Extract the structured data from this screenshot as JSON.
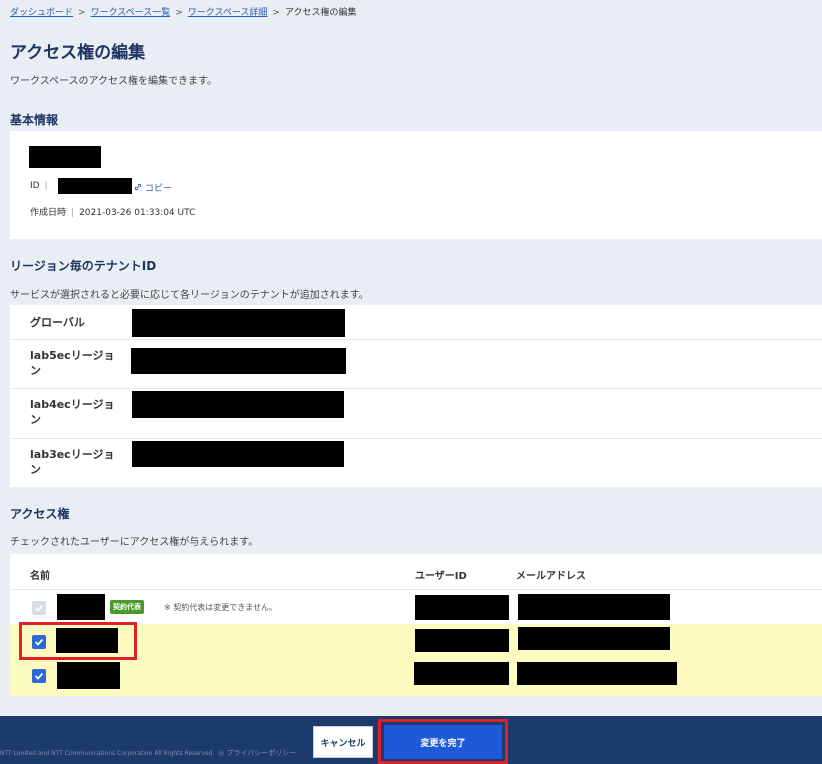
{
  "breadcrumb": {
    "items": [
      "ダッシュボード",
      "ワークスペース一覧",
      "ワークスペース詳細"
    ],
    "current": "アクセス権の編集",
    "separator": ">"
  },
  "page": {
    "title": "アクセス権の編集",
    "description": "ワークスペースのアクセス権を編集できます。"
  },
  "basic_info": {
    "heading": "基本情報",
    "id_label": "ID",
    "copy_label": "コピー",
    "created_label": "作成日時",
    "created_value": "2021-03-26 01:33:04 UTC"
  },
  "regions": {
    "heading": "リージョン毎のテナントID",
    "description": "サービスが選択されると必要に応じて各リージョンのテナントが追加されます。",
    "rows": [
      {
        "label": "グローバル"
      },
      {
        "label": "lab5ecリージョン"
      },
      {
        "label": "lab4ecリージョン"
      },
      {
        "label": "lab3ecリージョン"
      }
    ]
  },
  "access": {
    "heading": "アクセス権",
    "description": "チェックされたユーザーにアクセス権が与えられます。",
    "columns": {
      "name": "名前",
      "user_id": "ユーザーID",
      "email": "メールアドレス"
    },
    "rows": [
      {
        "checked": true,
        "disabled": true,
        "badge": "契約代表",
        "note": "※ 契約代表は変更できません。"
      },
      {
        "checked": true,
        "disabled": false
      },
      {
        "checked": true,
        "disabled": false
      }
    ]
  },
  "footer": {
    "copyright": "NTT Limited and NTT Communications Corporation All Rights Reserved.",
    "privacy": "プライバシーポリシー",
    "cancel_label": "キャンセル",
    "finish_label": "変更を完了"
  },
  "colors": {
    "heading": "#1f3561",
    "link": "#2a5db0",
    "primary": "#1e5ad8",
    "highlight_row": "#fefbc0",
    "annotation_red": "#e0202a",
    "badge_green": "#4a9a2a"
  }
}
